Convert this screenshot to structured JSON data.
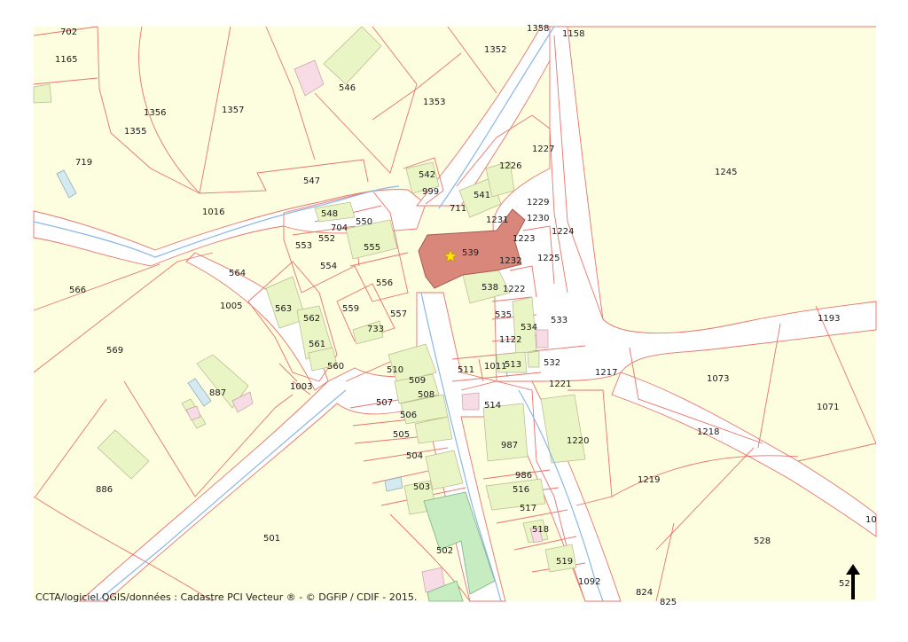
{
  "map": {
    "highlight_color": "#d9877a",
    "marker_icon": "star-icon",
    "parcel_labels": [
      {
        "id": "702"
      },
      {
        "id": "1165"
      },
      {
        "id": "1356"
      },
      {
        "id": "1355"
      },
      {
        "id": "1357"
      },
      {
        "id": "546"
      },
      {
        "id": "1358"
      },
      {
        "id": "1158"
      },
      {
        "id": "1352"
      },
      {
        "id": "1353"
      },
      {
        "id": "719"
      },
      {
        "id": "547"
      },
      {
        "id": "1016"
      },
      {
        "id": "542"
      },
      {
        "id": "999"
      },
      {
        "id": "1226"
      },
      {
        "id": "1227"
      },
      {
        "id": "541"
      },
      {
        "id": "711"
      },
      {
        "id": "1229"
      },
      {
        "id": "1231"
      },
      {
        "id": "1230"
      },
      {
        "id": "1224"
      },
      {
        "id": "1245"
      },
      {
        "id": "548"
      },
      {
        "id": "550"
      },
      {
        "id": "704"
      },
      {
        "id": "553"
      },
      {
        "id": "552"
      },
      {
        "id": "555"
      },
      {
        "id": "554"
      },
      {
        "id": "1223"
      },
      {
        "id": "539"
      },
      {
        "id": "1232"
      },
      {
        "id": "1225"
      },
      {
        "id": "566"
      },
      {
        "id": "564"
      },
      {
        "id": "556"
      },
      {
        "id": "538"
      },
      {
        "id": "1222"
      },
      {
        "id": "1005"
      },
      {
        "id": "563"
      },
      {
        "id": "562"
      },
      {
        "id": "559"
      },
      {
        "id": "557"
      },
      {
        "id": "535"
      },
      {
        "id": "533"
      },
      {
        "id": "1193"
      },
      {
        "id": "733"
      },
      {
        "id": "534"
      },
      {
        "id": "561"
      },
      {
        "id": "1122"
      },
      {
        "id": "569"
      },
      {
        "id": "560"
      },
      {
        "id": "510"
      },
      {
        "id": "509"
      },
      {
        "id": "511"
      },
      {
        "id": "1011"
      },
      {
        "id": "513"
      },
      {
        "id": "532"
      },
      {
        "id": "1217"
      },
      {
        "id": "1073"
      },
      {
        "id": "887"
      },
      {
        "id": "1003"
      },
      {
        "id": "508"
      },
      {
        "id": "1221"
      },
      {
        "id": "507"
      },
      {
        "id": "514"
      },
      {
        "id": "1071"
      },
      {
        "id": "506"
      },
      {
        "id": "1218"
      },
      {
        "id": "505"
      },
      {
        "id": "987"
      },
      {
        "id": "1220"
      },
      {
        "id": "504"
      },
      {
        "id": "986"
      },
      {
        "id": "1219"
      },
      {
        "id": "886"
      },
      {
        "id": "503"
      },
      {
        "id": "516"
      },
      {
        "id": "517"
      },
      {
        "id": "10"
      },
      {
        "id": "518"
      },
      {
        "id": "501"
      },
      {
        "id": "528"
      },
      {
        "id": "502"
      },
      {
        "id": "519"
      },
      {
        "id": "52"
      },
      {
        "id": "1092"
      },
      {
        "id": "824"
      },
      {
        "id": "825"
      }
    ]
  },
  "footer": {
    "credit": "CCTA/logiciel QGIS/données : Cadastre PCI Vecteur ® - © DGFiP / CDIF - 2015."
  },
  "north_arrow": {
    "icon": "north-arrow-icon"
  }
}
